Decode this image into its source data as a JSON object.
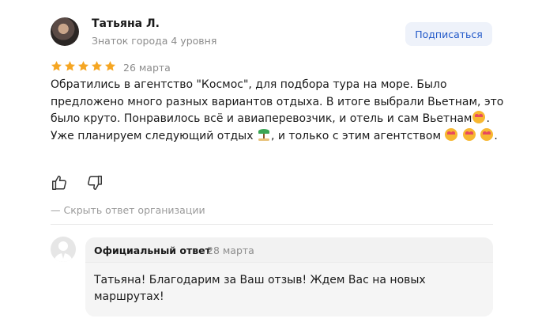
{
  "author": {
    "name": "Татьяна Л.",
    "level": "Знаток города 4 уровня"
  },
  "subscribe_label": "Подписаться",
  "rating": {
    "stars": 5,
    "max": 5
  },
  "review": {
    "date": "26 марта",
    "text_1": "Обратились в агентство \"Космос\", для подбора тура на море. Было предложено много разных вариантов отдыха. В итоге выбрали Вьетнам, это было круто. Понравилось всё и авиаперевозчик, и отель и сам Вьетнам",
    "text_2": ". Уже планируем следующий отдых",
    "text_3": ", и только с этим агентством",
    "text_4": "."
  },
  "toggle_reply_label": "— Скрыть ответ организации",
  "org_reply": {
    "title": "Официальный ответ",
    "date": "28 марта",
    "text": "Татьяна! Благодарим за Ваш отзыв! Ждем Вас на новых маршрутах!"
  },
  "colors": {
    "star": "#f5a623",
    "accent": "#2259c9",
    "button_bg": "#eef2fa",
    "muted": "#8c8c8c",
    "reply_bg": "#f2f2f2"
  },
  "icons": {
    "like": "thumbs-up-icon",
    "dislike": "thumbs-down-icon",
    "emoji": "smiling-face-with-hearts-emoji",
    "palm": "desert-island-emoji"
  }
}
